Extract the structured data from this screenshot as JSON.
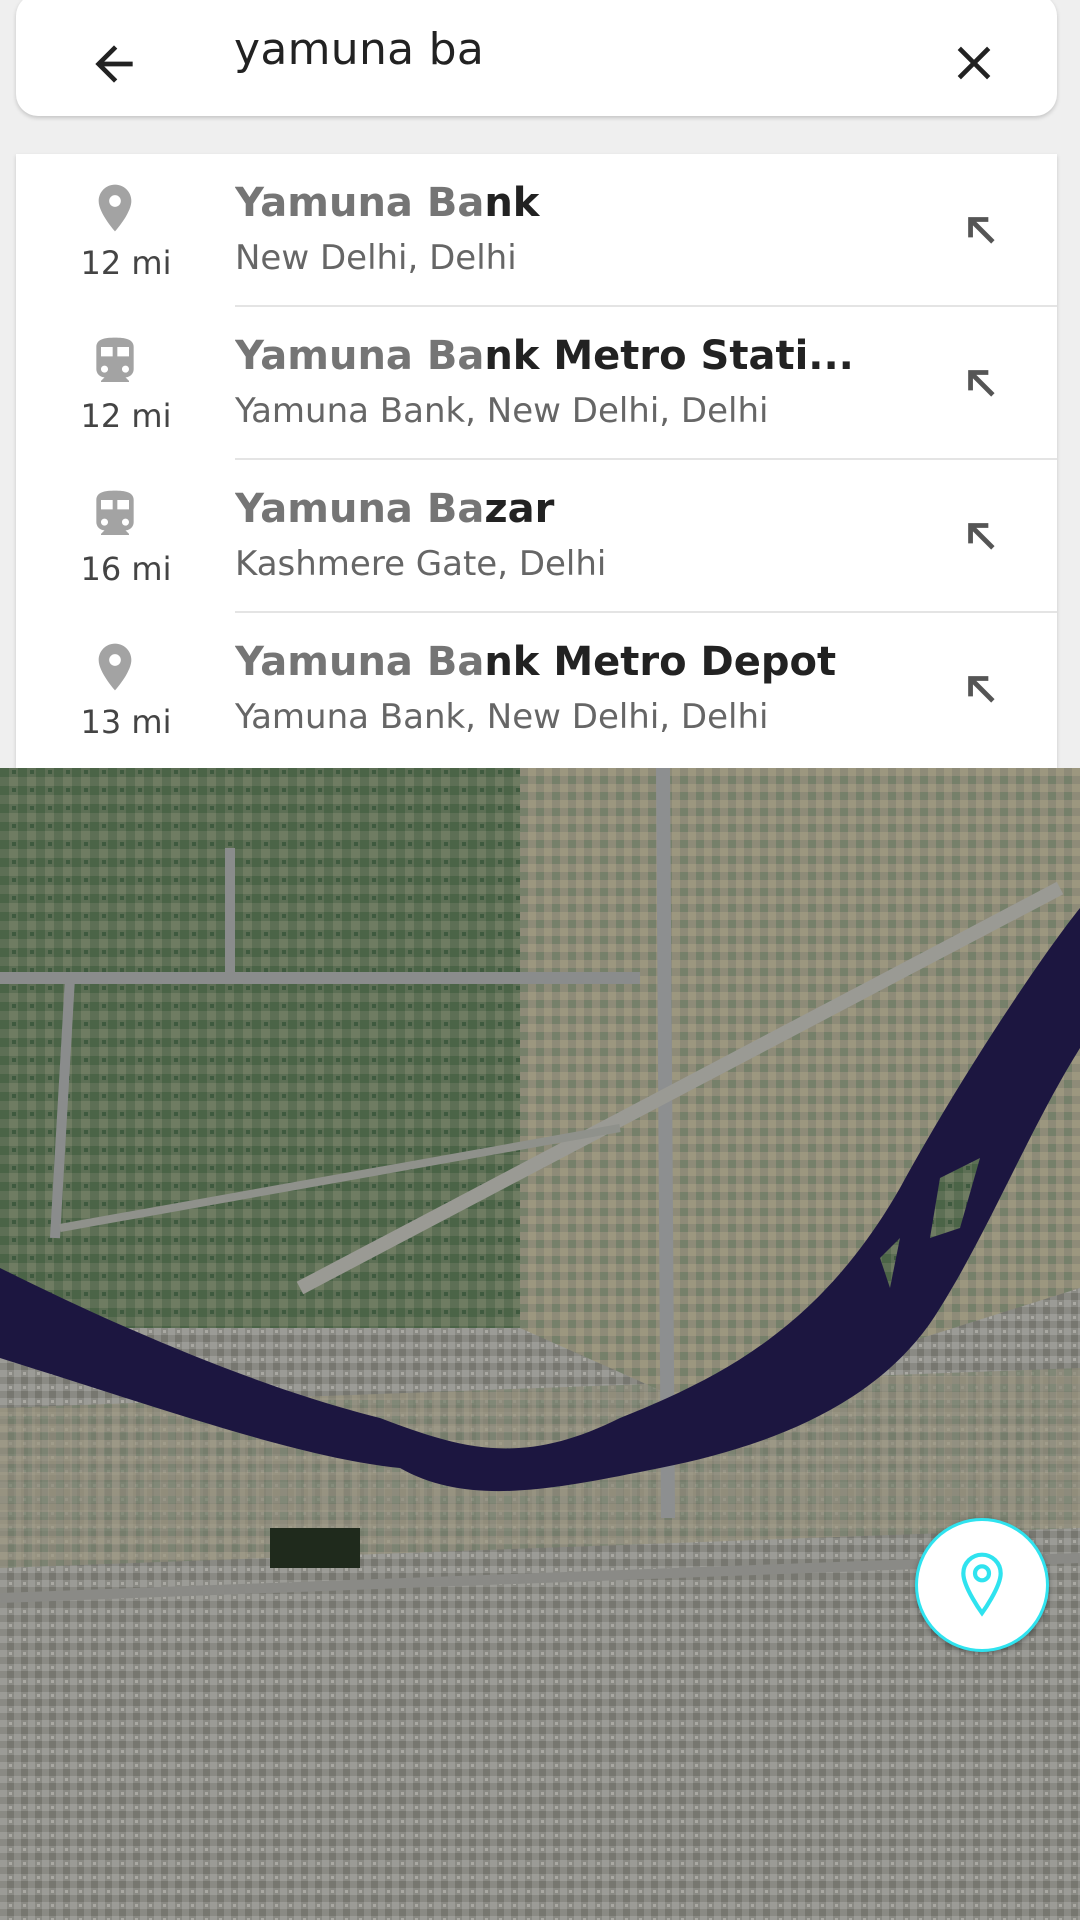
{
  "search": {
    "query": "yamuna ba",
    "back_icon": "arrow-left-icon",
    "clear_icon": "close-icon"
  },
  "suggestions": [
    {
      "icon": "place-pin-icon",
      "distance": "12 mi",
      "title_match": "Yamuna Ba",
      "title_rest": "nk",
      "subtitle": "New Delhi, Delhi"
    },
    {
      "icon": "transit-station-icon",
      "distance": "12 mi",
      "title_match": "Yamuna Ba",
      "title_rest": "nk Metro Stati...",
      "subtitle": "Yamuna Bank, New Delhi, Delhi"
    },
    {
      "icon": "transit-station-icon",
      "distance": "16 mi",
      "title_match": "Yamuna Ba",
      "title_rest": "zar",
      "subtitle": "Kashmere Gate, Delhi"
    },
    {
      "icon": "place-pin-icon",
      "distance": "13 mi",
      "title_match": "Yamuna Ba",
      "title_rest": "nk Metro Depot",
      "subtitle": "Yamuna Bank, New Delhi, Delhi"
    }
  ],
  "colors": {
    "accent": "#2fe3ef",
    "match_text": "#757575",
    "river": "#1c1640",
    "icon_gray": "#a3a3a3"
  },
  "fab": {
    "icon": "location-pin-icon"
  }
}
